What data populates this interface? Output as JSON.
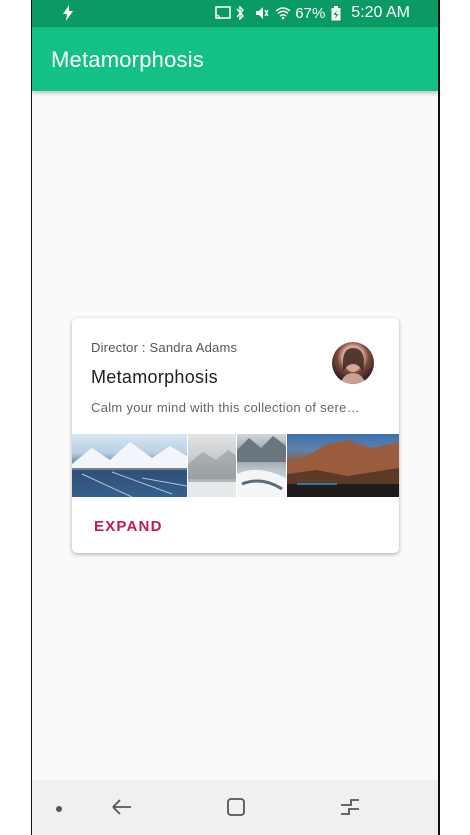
{
  "status_bar": {
    "battery_percent": "67%",
    "time": "5:20 AM",
    "icons": [
      "flash-icon",
      "cast-icon",
      "bluetooth-icon",
      "mute-icon",
      "wifi-icon",
      "battery-charging-icon"
    ]
  },
  "app_bar": {
    "title": "Metamorphosis",
    "color": "#12c183"
  },
  "card": {
    "director": "Director : Sandra Adams",
    "title": "Metamorphosis",
    "description": "Calm your mind with this collection of sere…",
    "expand_label": "EXPAND",
    "accent_color": "#c2185b",
    "images": [
      "frozen-lake-image",
      "foggy-mountain-image",
      "snowy-river-image",
      "red-cliffs-image"
    ]
  },
  "nav_bar": {
    "items": [
      "menu-dot",
      "back-icon",
      "home-icon",
      "recents-icon"
    ]
  }
}
